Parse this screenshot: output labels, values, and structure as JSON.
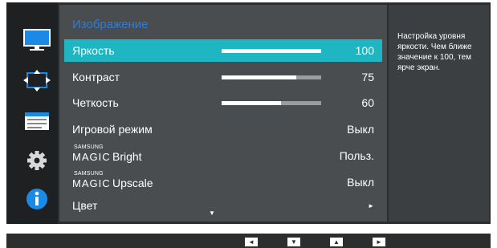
{
  "menu": {
    "title": "Изображение",
    "items": [
      {
        "label": "Яркость",
        "value": "100",
        "level": 100,
        "selected": true
      },
      {
        "label": "Контраст",
        "value": "75",
        "level": 75
      },
      {
        "label": "Четкость",
        "value": "60",
        "level": 60
      },
      {
        "label": "Игровой режим",
        "value": "Выкл"
      },
      {
        "brand_top": "SAMSUNG",
        "brand": "MAGIC",
        "label": "Bright",
        "value": "Польз."
      },
      {
        "brand_top": "SAMSUNG",
        "brand": "MAGIC",
        "label": "Upscale",
        "value": "Выкл"
      },
      {
        "label": "Цвет",
        "value": "►"
      }
    ],
    "scroll_indicator": "▼"
  },
  "sidebar": {
    "icons": [
      "monitor-icon",
      "position-icon",
      "settings-list-icon",
      "gear-icon",
      "info-icon"
    ],
    "active": "monitor-icon"
  },
  "help": {
    "text": "Настройка уровня яркости. Чем ближе значение к 100, тем ярче экран."
  },
  "navigation": {
    "buttons": [
      {
        "name": "left-button",
        "glyph": "◄"
      },
      {
        "name": "down-button",
        "glyph": "▼"
      },
      {
        "name": "up-button",
        "glyph": "▲"
      },
      {
        "name": "right-button",
        "glyph": "►"
      }
    ]
  },
  "colors": {
    "accent": "#1fb6c4",
    "title": "#2b7ed6",
    "info": "#1a8ae6"
  }
}
